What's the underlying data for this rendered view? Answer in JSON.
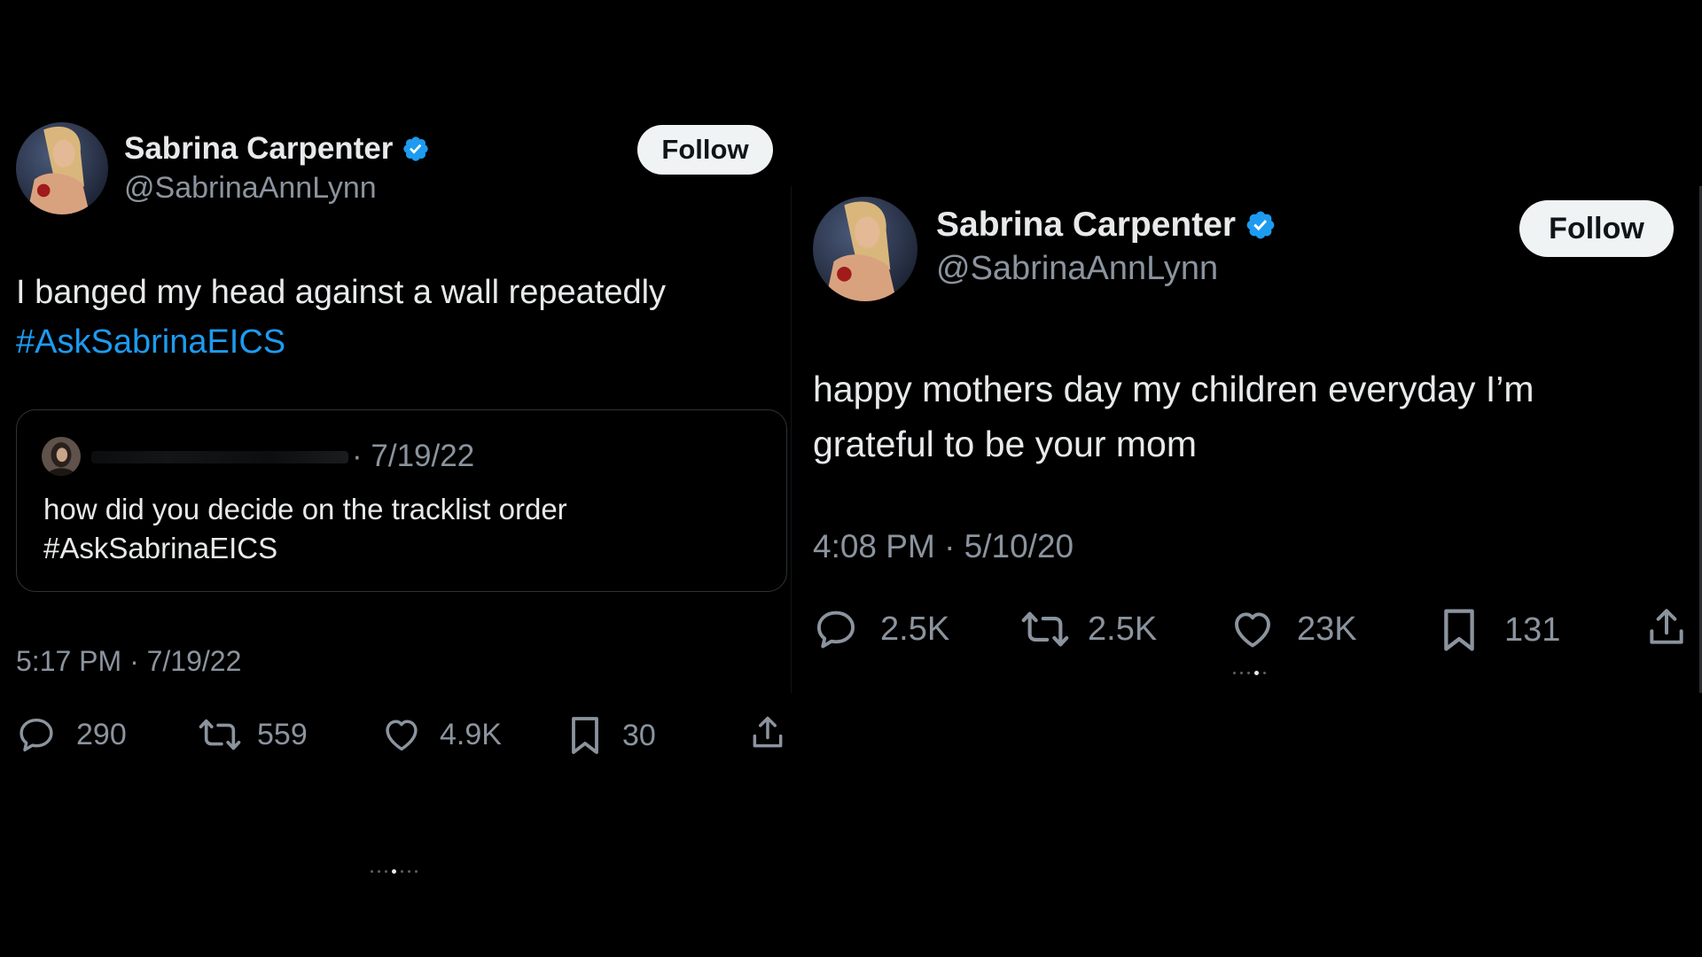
{
  "tweets": [
    {
      "author": {
        "name": "Sabrina Carpenter",
        "handle": "@SabrinaAnnLynn",
        "verified": true
      },
      "follow_label": "Follow",
      "text_line1": "I banged my head against a wall repeatedly",
      "hashtag": "#AskSabrinaEICS",
      "quoted": {
        "date": "· 7/19/22",
        "text_line1": "how did you decide on the tracklist order",
        "text_line2": "#AskSabrinaEICS"
      },
      "timestamp": "5:17 PM · 7/19/22",
      "stats": {
        "replies": "290",
        "retweets": "559",
        "likes": "4.9K",
        "bookmarks": "30"
      }
    },
    {
      "author": {
        "name": "Sabrina Carpenter",
        "handle": "@SabrinaAnnLynn",
        "verified": true
      },
      "follow_label": "Follow",
      "text_line1": "happy mothers day my children everyday I’m",
      "text_line2": "grateful to be your mom",
      "timestamp": "4:08 PM · 5/10/20",
      "stats": {
        "replies": "2.5K",
        "retweets": "2.5K",
        "likes": "23K",
        "bookmarks": "131"
      }
    }
  ],
  "colors": {
    "background": "#000000",
    "text": "#e7e9ea",
    "secondary": "#8b949e",
    "link": "#1d9bf0",
    "verified": "#1d9bf0",
    "follow_bg": "#eff3f4"
  },
  "icons": [
    "verified-badge-icon",
    "reply-icon",
    "retweet-icon",
    "like-icon",
    "bookmark-icon",
    "share-icon"
  ]
}
